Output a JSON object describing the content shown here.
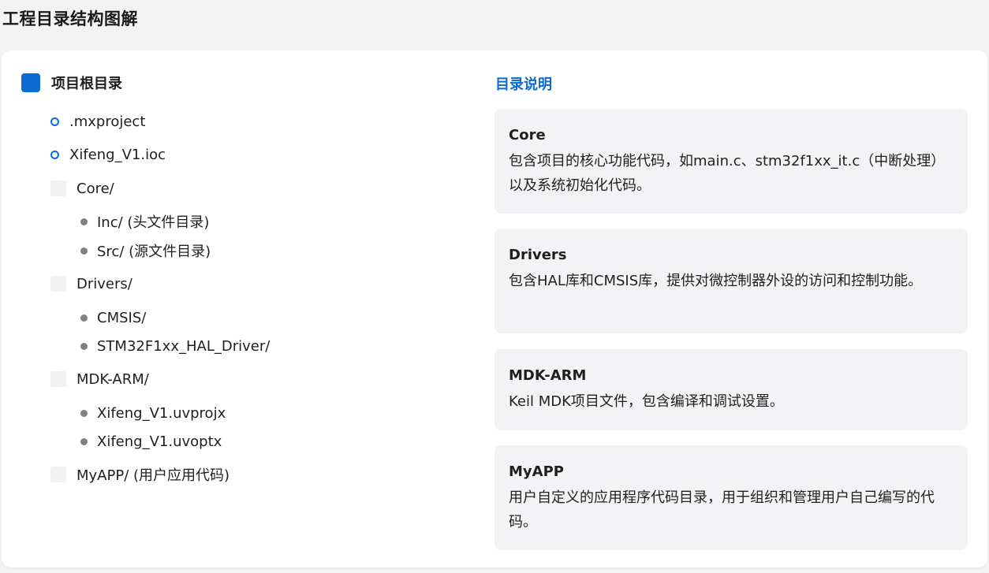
{
  "page_title": "工程目录结构图解",
  "tree": {
    "root_label": "项目根目录",
    "items": [
      {
        "kind": "file",
        "label": ".mxproject"
      },
      {
        "kind": "file",
        "label": "Xifeng_V1.ioc"
      },
      {
        "kind": "folder",
        "label": "Core/"
      },
      {
        "kind": "sub",
        "label": "Inc/ (头文件目录)"
      },
      {
        "kind": "sub",
        "label": "Src/ (源文件目录)"
      },
      {
        "kind": "folder",
        "label": "Drivers/"
      },
      {
        "kind": "sub",
        "label": "CMSIS/"
      },
      {
        "kind": "sub",
        "label": "STM32F1xx_HAL_Driver/"
      },
      {
        "kind": "folder",
        "label": "MDK-ARM/"
      },
      {
        "kind": "sub",
        "label": "Xifeng_V1.uvprojx"
      },
      {
        "kind": "sub",
        "label": "Xifeng_V1.uvoptx"
      },
      {
        "kind": "folder",
        "label": "MyAPP/ (用户应用代码)"
      }
    ]
  },
  "descriptions": {
    "heading": "目录说明",
    "items": [
      {
        "title": "Core",
        "text": "包含项目的核心功能代码，如main.c、stm32f1xx_it.c（中断处理）以及系统初始化代码。"
      },
      {
        "title": "Drivers",
        "text": "包含HAL库和CMSIS库，提供对微控制器外设的访问和控制功能。"
      },
      {
        "title": "MDK-ARM",
        "text": "Keil MDK项目文件，包含编译和调试设置。"
      },
      {
        "title": "MyAPP",
        "text": "用户自定义的应用程序代码目录，用于组织和管理用户自己编写的代码。"
      }
    ]
  },
  "colors": {
    "accent": "#0c6bd3",
    "background": "#f3f3f4",
    "card": "#ffffff",
    "desc_box": "#f3f3f5",
    "bullet": "#808080"
  }
}
